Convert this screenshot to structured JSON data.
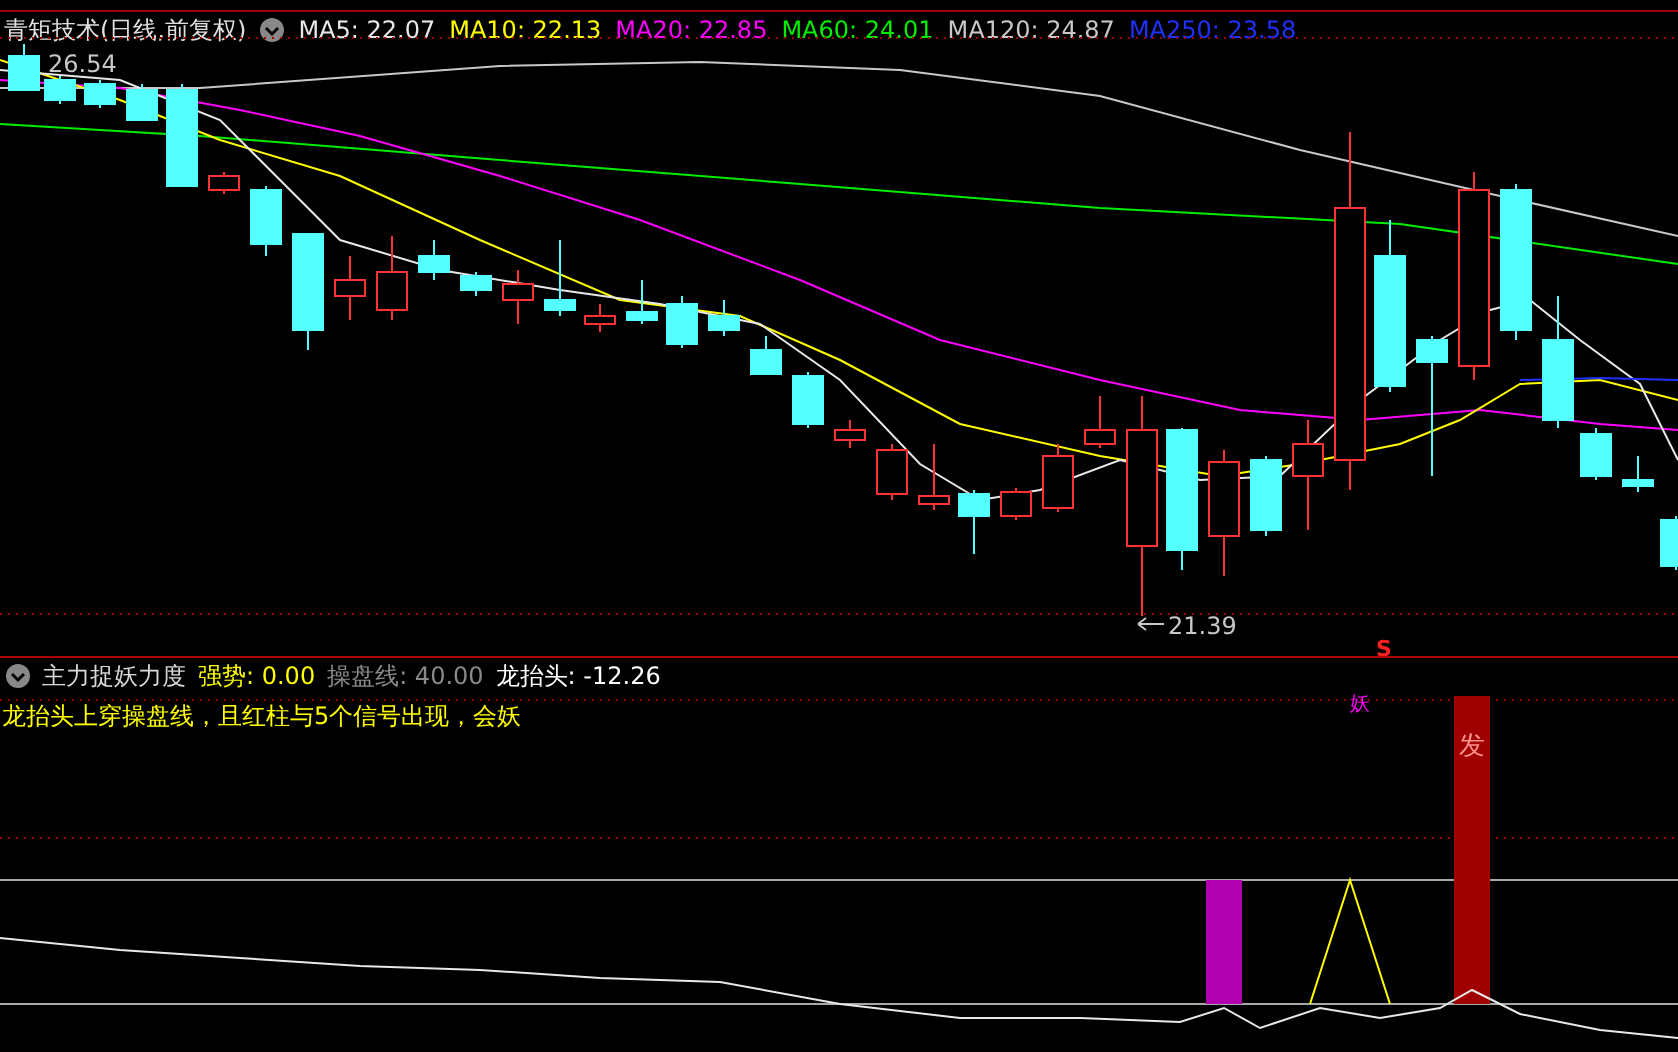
{
  "main_panel": {
    "title": "青矩技术(日线,前复权)",
    "moving_averages": [
      {
        "label": "MA5: 22.07",
        "color": "#e8e8e8"
      },
      {
        "label": "MA10: 22.13",
        "color": "#ffff00"
      },
      {
        "label": "MA20: 22.85",
        "color": "#ff00ff"
      },
      {
        "label": "MA60: 24.01",
        "color": "#00ee00"
      },
      {
        "label": "MA120: 24.87",
        "color": "#c8c8c8"
      },
      {
        "label": "MA250: 23.58",
        "color": "#2030ff"
      }
    ],
    "high_label": "26.54",
    "low_label": "21.39",
    "signal_mark": "S"
  },
  "indicator_panel": {
    "title": "主力捉妖力度",
    "values": [
      {
        "label": "强势: 0.00",
        "color": "#ffff00"
      },
      {
        "label": "操盘线: 40.00",
        "color": "#8a8a8a"
      },
      {
        "label": "龙抬头: -12.26",
        "color": "#ffffff"
      }
    ],
    "description": "龙抬头上穿操盘线，且红柱与5个信号出现，会妖",
    "marker_text": "妖",
    "bar_text": "发"
  }
}
